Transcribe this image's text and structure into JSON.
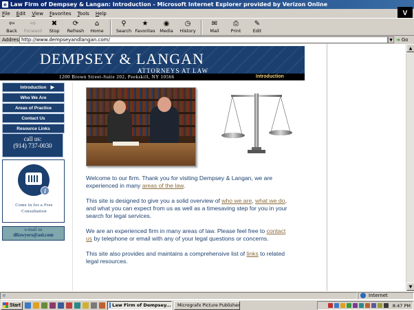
{
  "window": {
    "title": "Law Firm of Dempsey & Langan: Introduction - Microsoft Internet Explorer provided by Verizon Online"
  },
  "menu": [
    "File",
    "Edit",
    "View",
    "Favorites",
    "Tools",
    "Help"
  ],
  "brand_badge": "V",
  "toolbar": [
    {
      "label": "Back",
      "icon": "back-arrow-icon",
      "glyph": "⇦",
      "disabled": false
    },
    {
      "label": "Forward",
      "icon": "forward-arrow-icon",
      "glyph": "⇨",
      "disabled": true
    },
    {
      "label": "Stop",
      "icon": "stop-icon",
      "glyph": "✖",
      "disabled": false
    },
    {
      "label": "Refresh",
      "icon": "refresh-icon",
      "glyph": "⟳",
      "disabled": false
    },
    {
      "label": "Home",
      "icon": "home-icon",
      "glyph": "⌂",
      "disabled": false
    },
    {
      "label": "Search",
      "icon": "search-icon",
      "glyph": "⚲",
      "disabled": false
    },
    {
      "label": "Favorites",
      "icon": "favorites-icon",
      "glyph": "★",
      "disabled": false
    },
    {
      "label": "Media",
      "icon": "media-icon",
      "glyph": "◉",
      "disabled": false
    },
    {
      "label": "History",
      "icon": "history-icon",
      "glyph": "◷",
      "disabled": false
    },
    {
      "label": "Mail",
      "icon": "mail-icon",
      "glyph": "✉",
      "disabled": false
    },
    {
      "label": "Print",
      "icon": "print-icon",
      "glyph": "⎙",
      "disabled": false
    },
    {
      "label": "Edit",
      "icon": "edit-icon",
      "glyph": "✎",
      "disabled": false
    }
  ],
  "address": {
    "label": "Address",
    "url": "http://www.dempseyandlangan.com/",
    "go_label": "Go"
  },
  "site": {
    "firm_name": "DEMPSEY & LANGAN",
    "firm_subtitle": "ATTORNEYS AT LAW",
    "firm_address": "1200 Brown Street-Suite 202, Peekskill, NY 10566",
    "section_title": "Introduction",
    "nav": [
      "Introduction",
      "Who We Are",
      "Areas of Practice",
      "Contact Us",
      "Resource Links"
    ],
    "call_label": "call us:",
    "call_number": "(914) 737-0030",
    "consult_text": "Come in for a Free Consultation",
    "email_label": "e-mail us",
    "email_address": "dllawyers@aol.com",
    "paragraphs": [
      {
        "before": "Welcome to our firm. Thank you for visiting Dempsey & Langan, we are experienced in many ",
        "link": "areas of the law",
        "after": "."
      },
      {
        "before": "This site is designed to give you a solid overview of ",
        "link": "who we are",
        "middle": ", ",
        "link2": "what we do",
        "after": ", and what you can expect from us as well as a timesaving step for you in your search for legal services."
      },
      {
        "before": "We are an experienced firm in many areas of law. Please feel free to ",
        "link": "contact us",
        "after": " by telephone or email with any of your legal questions or concerns."
      },
      {
        "before": "This site also provides and maintains a comprehensive list of ",
        "link": "links",
        "after": " to related legal resources."
      }
    ]
  },
  "status": {
    "zone": "Internet"
  },
  "taskbar": {
    "start": "Start",
    "tasks": [
      {
        "label": "Law Firm of Dempsey...",
        "active": true
      },
      {
        "label": "Micrografx Picture Publisher",
        "active": false
      }
    ],
    "clock": "8:47 PM"
  },
  "colors": {
    "navy": "#1b3f6e",
    "link": "#8a6a3a",
    "title_bar": "#0a246a",
    "email_box": "#7fa7ac"
  }
}
